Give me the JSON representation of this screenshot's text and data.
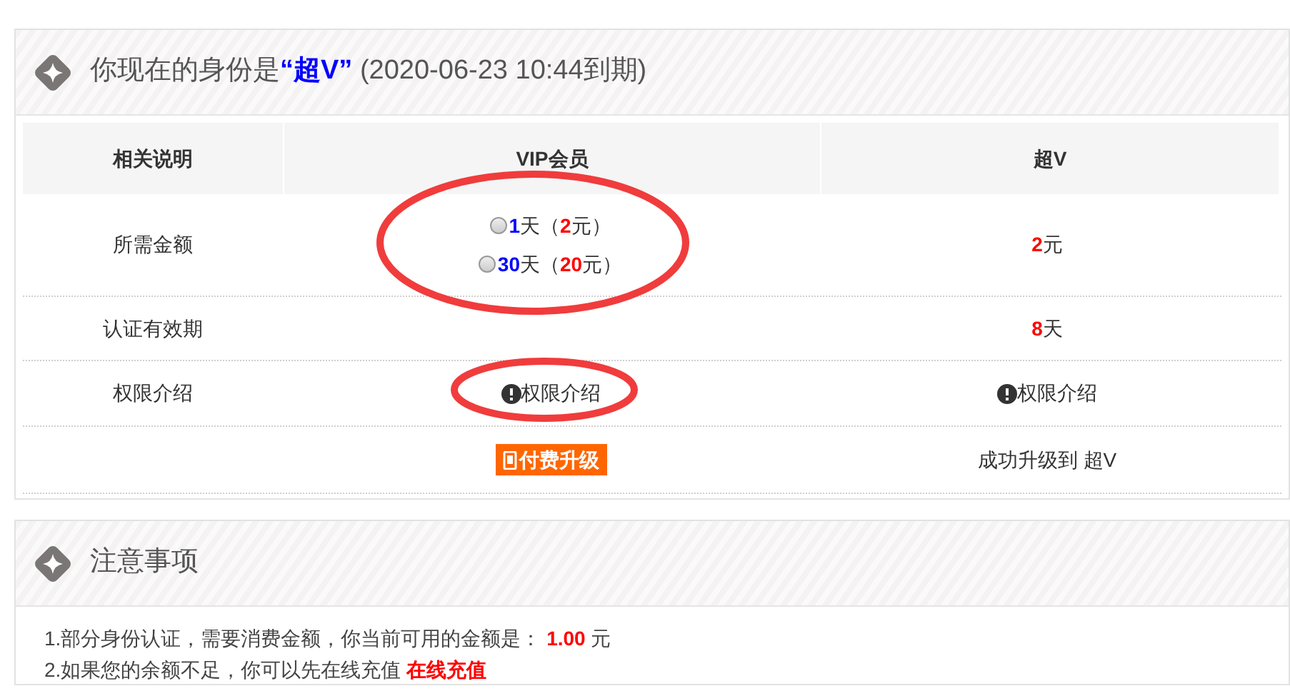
{
  "status_panel": {
    "title": [
      {
        "text": "你现在的身份是"
      },
      {
        "text": "“超V”",
        "color": "#0000ff"
      },
      {
        "text": " (2020-06-23 10:44到期)"
      }
    ],
    "table": {
      "columns": [
        "相关说明",
        "VIP会员",
        "超V"
      ],
      "rows": [
        {
          "label": "所需金额",
          "vip": {
            "kind": "options",
            "options": [
              {
                "selected": false,
                "parts": [
                  {
                    "text": "1",
                    "color": "#0000ff"
                  },
                  {
                    "text": "天（"
                  },
                  {
                    "text": "2",
                    "color": "#ff0000"
                  },
                  {
                    "text": "元）"
                  }
                ]
              },
              {
                "selected": false,
                "parts": [
                  {
                    "text": "30",
                    "color": "#0000ff"
                  },
                  {
                    "text": "天（"
                  },
                  {
                    "text": "20",
                    "color": "#ff0000"
                  },
                  {
                    "text": "元）"
                  }
                ]
              }
            ]
          },
          "super": {
            "kind": "text",
            "parts": [
              {
                "text": "2",
                "color": "#ff0000"
              },
              {
                "text": "元"
              }
            ]
          }
        },
        {
          "label": "认证有效期",
          "super": {
            "kind": "text",
            "parts": [
              {
                "text": "8",
                "color": "#ff0000"
              },
              {
                "text": "天"
              }
            ]
          }
        },
        {
          "label": "权限介绍",
          "vip": {
            "kind": "info",
            "text": "权限介绍"
          },
          "super": {
            "kind": "info",
            "text": "权限介绍"
          }
        },
        {
          "vip": {
            "kind": "button",
            "text": "付费升级"
          },
          "super": {
            "kind": "text",
            "parts": [
              {
                "text": "成功升级到 超V"
              }
            ]
          }
        }
      ]
    }
  },
  "notes_panel": {
    "title": "注意事项",
    "items": [
      {
        "parts": [
          {
            "text": "1.部分身份认证，需要消费金额，你当前可用的金额是： "
          },
          {
            "text": "1.00",
            "color": "#ff0000"
          },
          {
            "text": " 元"
          }
        ]
      },
      {
        "parts": [
          {
            "text": "2.如果您的余额不足，你可以先在线充值 "
          },
          {
            "text": "在线充值",
            "color": "#ff0000"
          }
        ]
      }
    ]
  }
}
